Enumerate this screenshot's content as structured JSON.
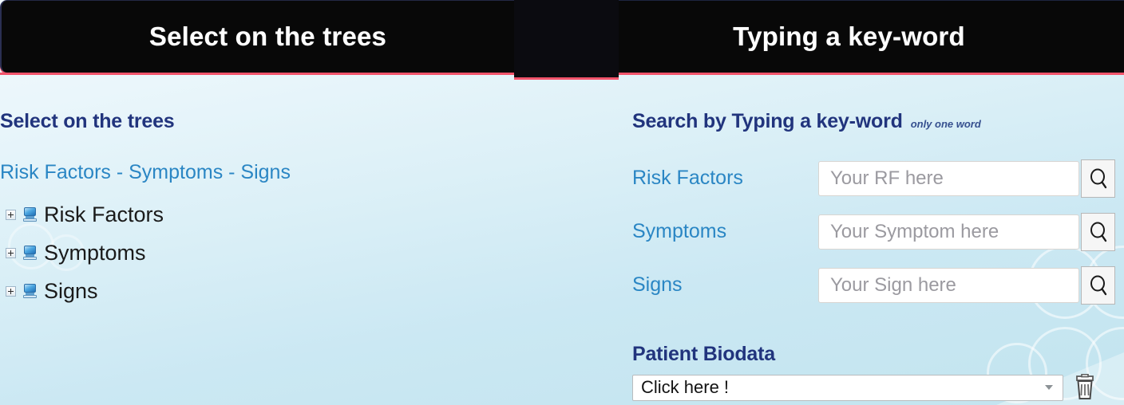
{
  "banners": {
    "left_title": "Select on the trees",
    "right_title": "Typing a key-word"
  },
  "left_panel": {
    "heading": "Select on the trees",
    "tree_legend": "Risk Factors - Symptoms - Signs",
    "tree_nodes": [
      {
        "label": "Risk Factors",
        "expander": "plus-box-icon",
        "icon": "tree-node-icon"
      },
      {
        "label": "Symptoms",
        "expander": "plus-box-icon",
        "icon": "tree-node-icon"
      },
      {
        "label": "Signs",
        "expander": "plus-box-icon",
        "icon": "tree-node-icon"
      }
    ]
  },
  "right_panel": {
    "heading": "Search by Typing a key-word",
    "heading_note": "only one word",
    "search_rows": [
      {
        "label": "Risk Factors",
        "placeholder": "Your RF here",
        "value": "",
        "button_icon": "search-icon"
      },
      {
        "label": "Symptoms",
        "placeholder": "Your Symptom here",
        "value": "",
        "button_icon": "search-icon"
      },
      {
        "label": "Signs",
        "placeholder": "Your Sign here",
        "value": "",
        "button_icon": "search-icon"
      }
    ],
    "biodata": {
      "heading": "Patient Biodata",
      "selected": "Click here !",
      "dropdown_icon": "chevron-down-icon",
      "delete_icon": "trash-icon"
    }
  },
  "colors": {
    "banner_bg": "#080808",
    "banner_text": "#ffffff",
    "accent_red": "#f2546b",
    "heading_navy": "#21347d",
    "link_blue": "#2a86c4",
    "background_top": "#f2f9fc",
    "background_bottom": "#c2e4ef"
  }
}
